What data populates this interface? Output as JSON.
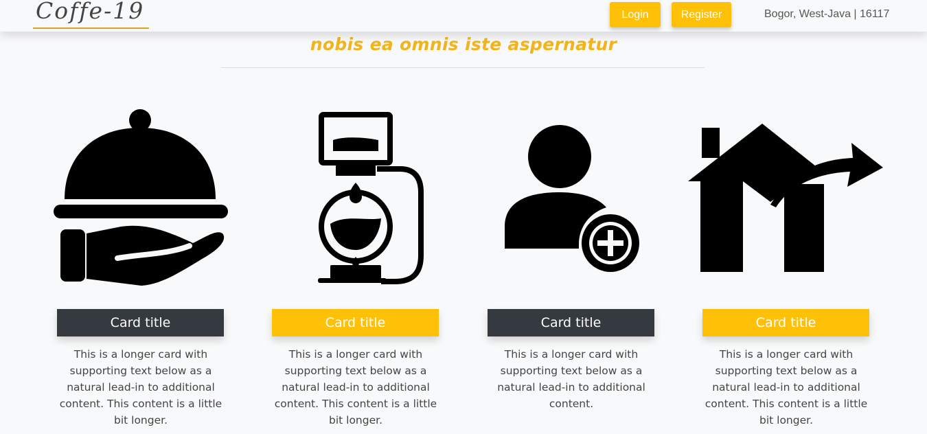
{
  "navbar": {
    "brand": "Coffe-19",
    "login_label": "Login",
    "register_label": "Register",
    "address": "Bogor, West-Java | 16117"
  },
  "section": {
    "heading": "nobis ea omnis iste aspernatur"
  },
  "cards": [
    {
      "icon": "serving-tray-hand-icon",
      "title": "Card title",
      "title_color": "#343a40",
      "text": "This is a longer card with supporting text below as a natural lead-in to additional content. This content is a little bit longer."
    },
    {
      "icon": "siphon-coffee-maker-icon",
      "title": "Card title",
      "title_color": "#ffc107",
      "text": "This is a longer card with supporting text below as a natural lead-in to additional content. This content is a little bit longer."
    },
    {
      "icon": "add-user-icon",
      "title": "Card title",
      "title_color": "#343a40",
      "text": "This is a longer card with supporting text below as a natural lead-in to additional content."
    },
    {
      "icon": "house-exit-arrow-icon",
      "title": "Card title",
      "title_color": "#ffc107",
      "text": "This is a longer card with supporting text below as a natural lead-in to additional content. This content is a little bit longer."
    }
  ],
  "colors": {
    "accent": "#ffc107",
    "dark": "#343a40",
    "heading": "#f3b41b"
  }
}
